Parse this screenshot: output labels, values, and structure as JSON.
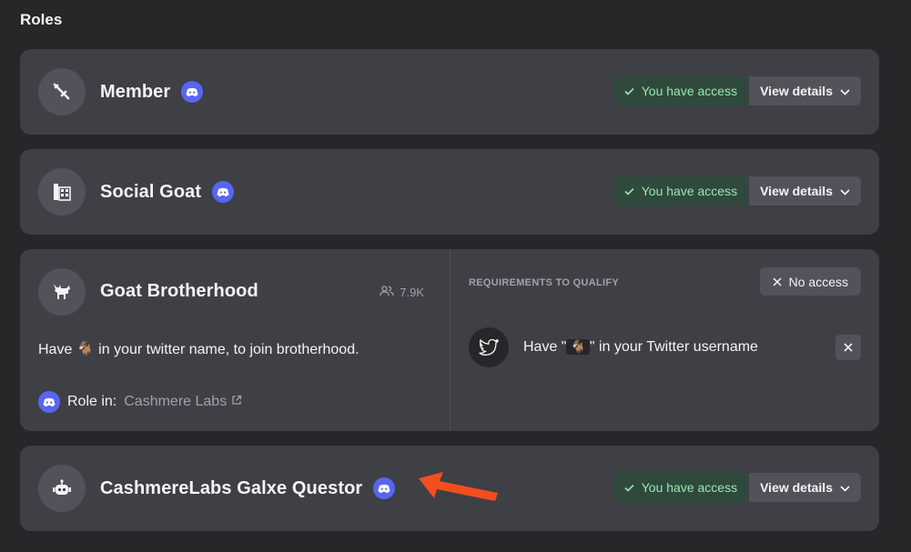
{
  "section_title": "Roles",
  "roles": [
    {
      "name": "Member",
      "avatar_icon": "sword-icon",
      "access_label": "You have access",
      "details_label": "View details"
    },
    {
      "name": "Social Goat",
      "avatar_icon": "phone-grid-icon",
      "access_label": "You have access",
      "details_label": "View details"
    },
    {
      "name": "Goat Brotherhood",
      "avatar_icon": "goat-icon",
      "member_count": "7.9K",
      "description": "Have 🐐 in your twitter name, to join brotherhood.",
      "role_in_label": "Role in:",
      "role_in_link": "Cashmere Labs",
      "requirements_title": "REQUIREMENTS TO QUALIFY",
      "no_access_label": "No access",
      "requirement_prefix": "Have \"",
      "requirement_emoji": "🐐",
      "requirement_suffix": "\" in your Twitter username"
    },
    {
      "name": "CashmereLabs Galxe Questor",
      "avatar_icon": "robot-icon",
      "access_label": "You have access",
      "details_label": "View details"
    }
  ],
  "colors": {
    "background": "#27272a",
    "card": "#3f3f46",
    "discord": "#5865f2",
    "access_green": "#9ae6b4",
    "arrow": "#f24e1e"
  }
}
